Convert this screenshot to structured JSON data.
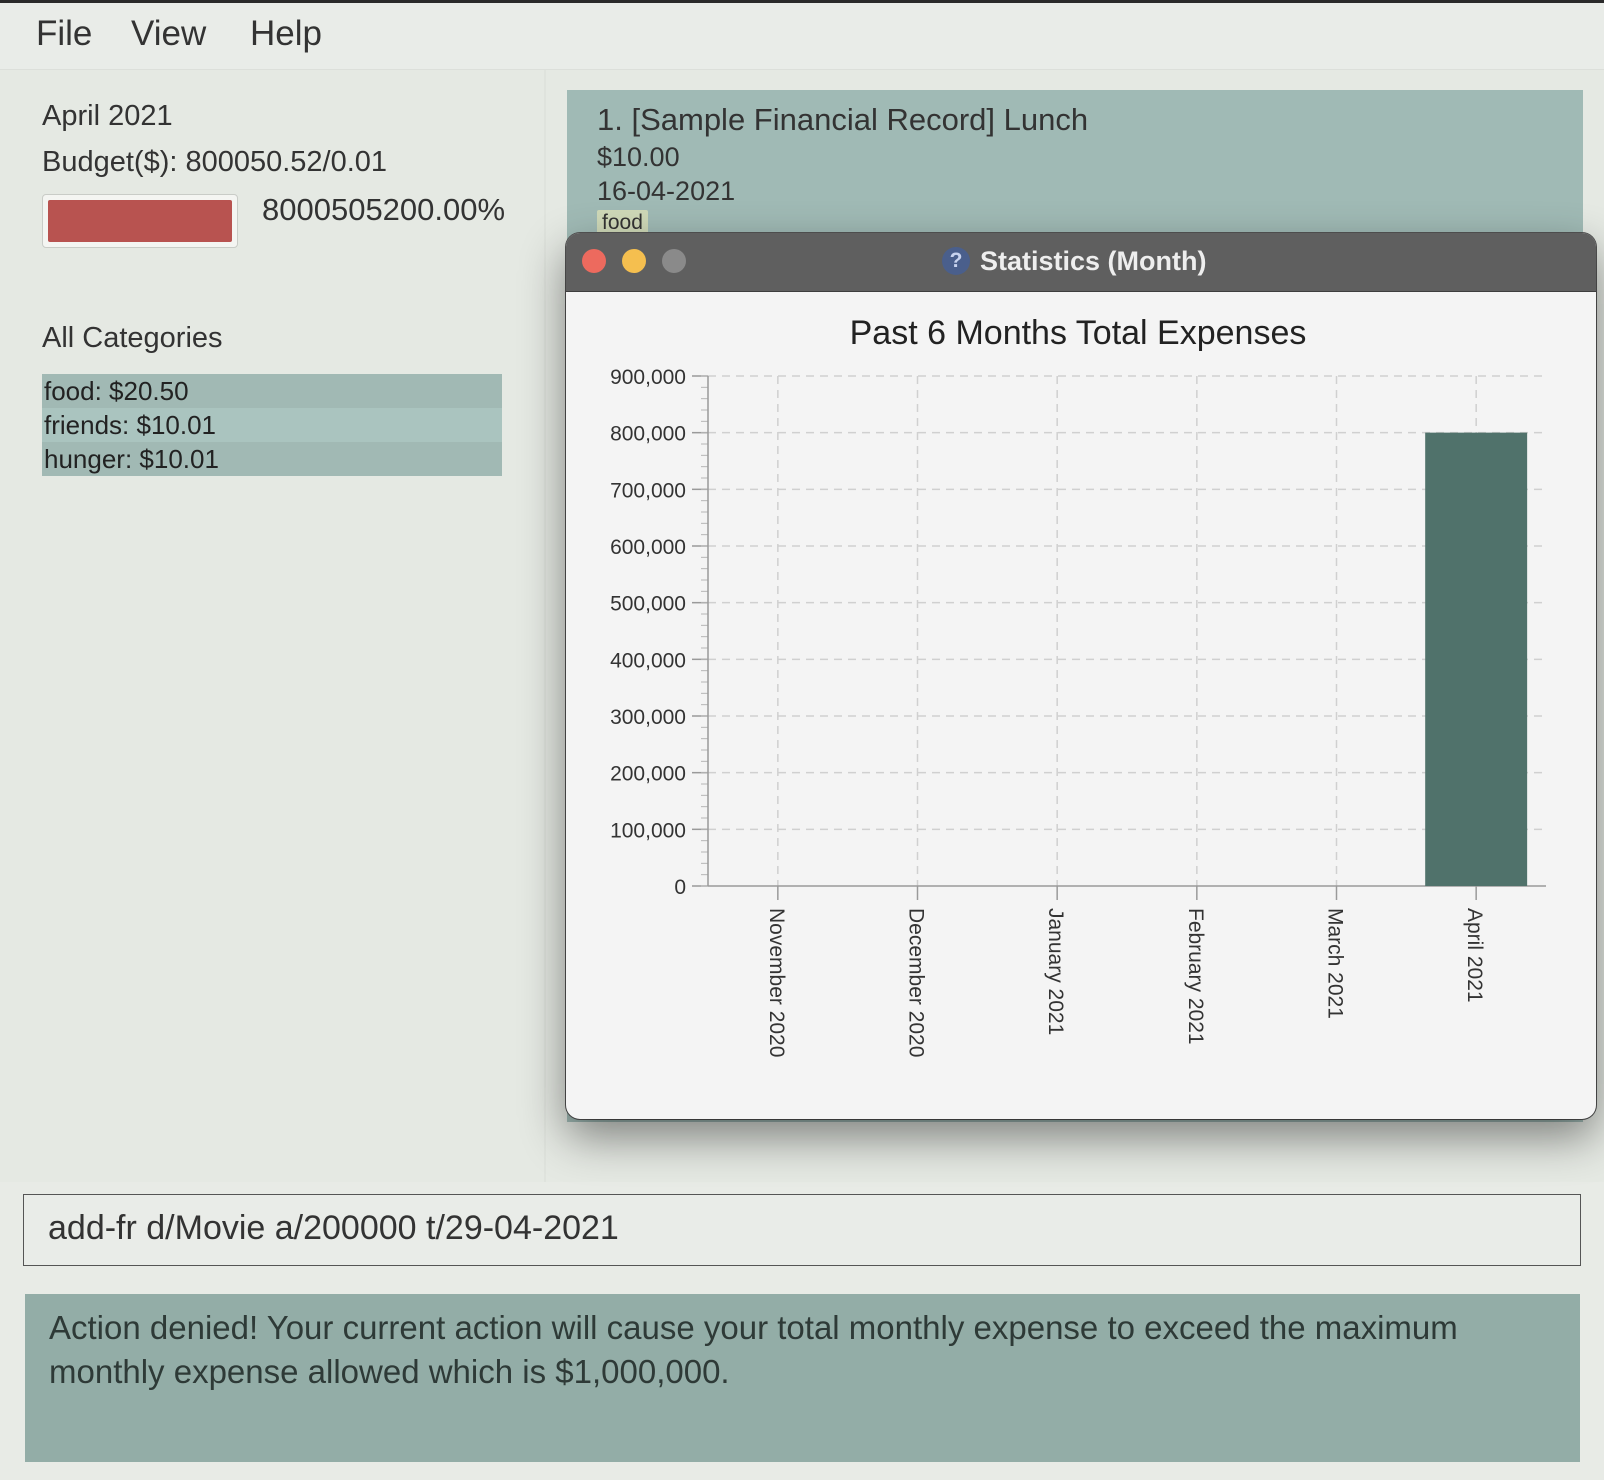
{
  "menubar": {
    "items": [
      "File",
      "View",
      "Help"
    ]
  },
  "budget_panel": {
    "month": "April 2021",
    "budget_label": "Budget($): 800050.52/0.01",
    "progress_text": "8000505200.00%",
    "progress_fraction": 1.0,
    "progress_color": "#b85350"
  },
  "categories": {
    "title": "All Categories",
    "items": [
      "food: $20.50",
      "friends: $10.01",
      "hunger: $10.01"
    ]
  },
  "record": {
    "title": "1.  [Sample Financial Record] Lunch",
    "amount": "$10.00",
    "date": "16-04-2021",
    "tag": "food"
  },
  "stats_window": {
    "title": "Statistics (Month)",
    "help_icon": "question-icon",
    "traffic_lights": [
      "close",
      "minimize",
      "zoom"
    ]
  },
  "chart_data": {
    "type": "bar",
    "title": "Past 6 Months Total Expenses",
    "categories": [
      "November 2020",
      "December 2020",
      "January 2021",
      "February 2021",
      "March 2021",
      "April 2021"
    ],
    "values": [
      0,
      0,
      0,
      0,
      0,
      800050.52
    ],
    "ylim": [
      0,
      900000
    ],
    "yticks": [
      "0",
      "100,000",
      "200,000",
      "300,000",
      "400,000",
      "500,000",
      "600,000",
      "700,000",
      "800,000",
      "900,000"
    ],
    "grid": true,
    "bar_color": "#50726b",
    "xlabel": "",
    "ylabel": ""
  },
  "command_box": {
    "value": "add-fr d/Movie a/200000 t/29-04-2021"
  },
  "result_box": {
    "message": "Action denied! Your current action will cause your total monthly expense to exceed the maximum monthly expense allowed which is $1,000,000."
  }
}
